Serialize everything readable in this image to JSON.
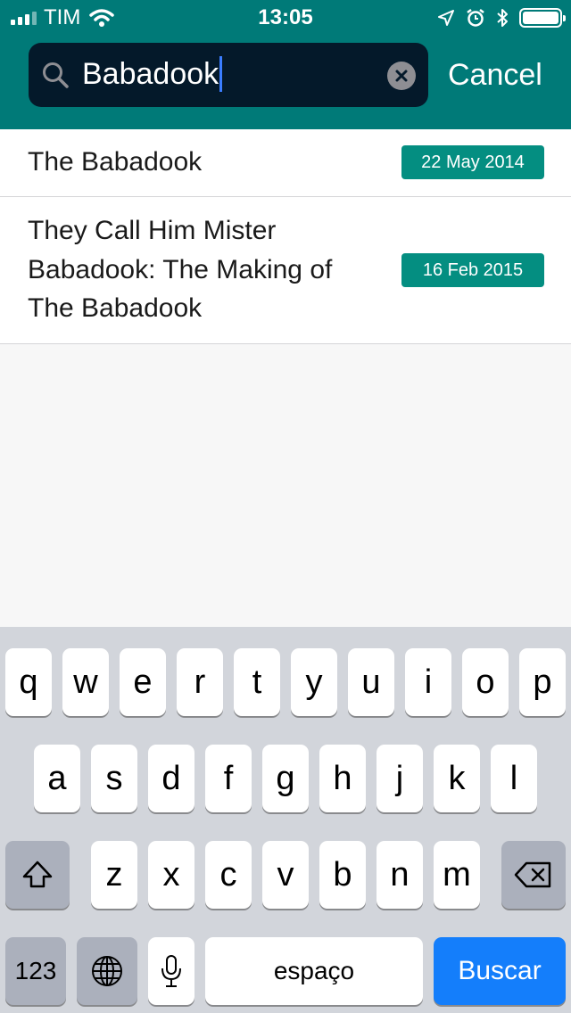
{
  "status_bar": {
    "carrier": "TIM",
    "time": "13:05"
  },
  "search": {
    "query": "Babadook",
    "cancel_label": "Cancel"
  },
  "results": [
    {
      "title": "The Babadook",
      "date": "22 May 2014"
    },
    {
      "title": "They Call Him Mister Babadook: The Making of The Babadook",
      "date": "16 Feb 2015"
    }
  ],
  "keyboard": {
    "row1": [
      "q",
      "w",
      "e",
      "r",
      "t",
      "y",
      "u",
      "i",
      "o",
      "p"
    ],
    "row2": [
      "a",
      "s",
      "d",
      "f",
      "g",
      "h",
      "j",
      "k",
      "l"
    ],
    "row3": [
      "z",
      "x",
      "c",
      "v",
      "b",
      "n",
      "m"
    ],
    "numbers_label": "123",
    "space_label": "espaço",
    "return_label": "Buscar"
  },
  "colors": {
    "header": "#007a78",
    "badge": "#048e81",
    "search_field": "#04192a",
    "return_key": "#147efb"
  },
  "icons": [
    "signal-bars-icon",
    "wifi-icon",
    "location-arrow-icon",
    "alarm-icon",
    "bluetooth-icon",
    "battery-icon",
    "search-icon",
    "clear-icon",
    "shift-icon",
    "backspace-icon",
    "globe-icon",
    "microphone-icon"
  ]
}
